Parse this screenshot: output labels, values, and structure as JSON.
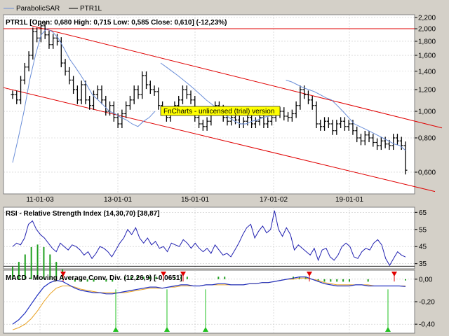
{
  "legend": [
    {
      "name": "ParabolicSAR",
      "color": "#6a8ed8"
    },
    {
      "name": "PTR1L",
      "color": "#000000"
    }
  ],
  "colors": {
    "panel_bg": "#ffffff",
    "frame_bg": "#d4d0c8",
    "channel": "#e00000",
    "sar": "#6a8ed8",
    "price": "#000000",
    "rsi": "#2020b0",
    "macd_line": "#2030c0",
    "signal_line": "#e8a020",
    "macd_hist": "#20a020",
    "marker_down": "#e00000",
    "marker_up": "#20c020",
    "watermark_bg": "#ffff00"
  },
  "price_panel": {
    "header": "PTR1L [Open: 0,680  High: 0,715  Low: 0,585  Close: 0,610] (-12,23%)",
    "watermark": "FnCharts - unlicensed (trial) version",
    "y_ticks": [
      "2,200",
      "2,000",
      "1,800",
      "1,600",
      "1,400",
      "1,200",
      "1,000",
      "0,800",
      "0,600"
    ],
    "x_ticks": [
      "11-01-03",
      "13-01-01",
      "15-01-01",
      "17-01-02",
      "19-01-01"
    ]
  },
  "rsi_panel": {
    "header": "RSI - Relative Strength Index (14,30,70) [38,87]",
    "y_ticks": [
      "65",
      "55",
      "45",
      "35"
    ]
  },
  "macd_panel": {
    "header": "MACD - Moving Average Conv. Div. (12,26,9) [-0,0651]",
    "y_ticks": [
      "0,00",
      "-0,20",
      "-0,40"
    ]
  },
  "chart_data": [
    {
      "type": "ohlc",
      "title": "PTR1L",
      "scale": "log",
      "ylim": [
        0.5,
        2.2
      ],
      "x_tick_labels": [
        "11-01-03",
        "13-01-01",
        "15-01-01",
        "17-01-02",
        "19-01-01"
      ],
      "series": [
        {
          "name": "PTR1L",
          "close": [
            1.15,
            1.1,
            1.3,
            1.45,
            1.6,
            1.95,
            1.85,
            2.05,
            1.9,
            1.75,
            1.85,
            1.8,
            1.5,
            1.4,
            1.3,
            1.2,
            1.1,
            1.25,
            1.1,
            1.05,
            1.15,
            1.2,
            1.1,
            1.0,
            1.05,
            0.95,
            0.9,
            0.98,
            1.05,
            1.1,
            1.2,
            1.15,
            1.35,
            1.25,
            1.2,
            1.18,
            1.05,
            1.0,
            0.95,
            1.0,
            1.05,
            1.1,
            1.2,
            1.15,
            1.1,
            0.95,
            0.9,
            0.88,
            0.92,
            1.0,
            1.05,
            1.02,
            0.95,
            0.92,
            0.95,
            0.93,
            0.9,
            0.92,
            0.95,
            0.9,
            0.92,
            0.95,
            0.9,
            0.92,
            0.95,
            0.98,
            1.0,
            0.96,
            0.95,
            0.98,
            1.05,
            1.2,
            1.15,
            1.1,
            1.05,
            0.9,
            0.88,
            0.92,
            0.9,
            0.85,
            0.9,
            0.92,
            0.88,
            0.9,
            0.85,
            0.8,
            0.78,
            0.82,
            0.8,
            0.77,
            0.75,
            0.78,
            0.76,
            0.75,
            0.8,
            0.78,
            0.75,
            0.61
          ]
        },
        {
          "name": "ParabolicSAR",
          "values": [
            0.65,
            0.8,
            1.0,
            1.3,
            1.6,
            1.9,
            2.0,
            1.95,
            1.85,
            1.7,
            1.55,
            1.45,
            1.35,
            1.25,
            1.15,
            1.1,
            1.05,
            1.0,
            0.98,
            0.95,
            0.93,
            0.9,
            0.88,
            0.92,
            0.95,
            1.0,
            1.5,
            1.45,
            1.4,
            1.35,
            1.3,
            1.25,
            1.2,
            1.15,
            1.1,
            1.06,
            1.02,
            0.98,
            0.95,
            0.92,
            0.9,
            0.9,
            0.92,
            0.93,
            0.95,
            0.96,
            0.97,
            0.98,
            1.3,
            1.28,
            1.25,
            1.22,
            1.2,
            1.18,
            1.15,
            1.12,
            1.1,
            1.05,
            1.0,
            0.95,
            0.9,
            0.88,
            0.86,
            0.84,
            0.82,
            0.8,
            0.78,
            0.76,
            0.75,
            0.72
          ]
        }
      ]
    },
    {
      "type": "line",
      "title": "RSI - Relative Strength Index (14,30,70)",
      "ylim": [
        32,
        68
      ],
      "series": [
        {
          "name": "RSI",
          "values": [
            45,
            47,
            46,
            50,
            58,
            60,
            55,
            52,
            50,
            47,
            44,
            42,
            47,
            45,
            43,
            46,
            45,
            43,
            40,
            42,
            38,
            41,
            45,
            44,
            42,
            39,
            43,
            47,
            50,
            55,
            52,
            56,
            50,
            47,
            50,
            46,
            48,
            44,
            45,
            42,
            47,
            46,
            45,
            49,
            47,
            44,
            47,
            44,
            42,
            44,
            41,
            46,
            43,
            40,
            41,
            39,
            43,
            47,
            52,
            56,
            58,
            50,
            54,
            57,
            53,
            55,
            66,
            55,
            51,
            56,
            52,
            43,
            46,
            44,
            42,
            40,
            44,
            37,
            43,
            44,
            39,
            37,
            40,
            45,
            47,
            45,
            39,
            38,
            42,
            44,
            43,
            47,
            49,
            46,
            38,
            34,
            38,
            42,
            40,
            38.87
          ]
        }
      ]
    },
    {
      "type": "line",
      "title": "MACD - Moving Average Conv. Div. (12,26,9)",
      "ylim": [
        -0.48,
        0.08
      ],
      "series": [
        {
          "name": "MACD",
          "values": [
            -0.4,
            -0.36,
            -0.3,
            -0.22,
            -0.14,
            -0.07,
            -0.03,
            -0.01,
            -0.02,
            -0.05,
            -0.08,
            -0.1,
            -0.11,
            -0.12,
            -0.12,
            -0.13,
            -0.13,
            -0.12,
            -0.11,
            -0.1,
            -0.09,
            -0.08,
            -0.07,
            -0.07,
            -0.08,
            -0.07,
            -0.06,
            -0.05,
            -0.05,
            -0.06,
            -0.06,
            -0.05,
            -0.05,
            -0.04,
            -0.04,
            -0.05,
            -0.05,
            -0.05,
            -0.04,
            -0.04,
            -0.03,
            -0.03,
            -0.02,
            -0.01,
            0.0,
            0.01,
            0.02,
            0.02,
            0.0,
            -0.02,
            -0.04,
            -0.05,
            -0.06,
            -0.06,
            -0.06,
            -0.05,
            -0.05,
            -0.06,
            -0.06,
            -0.06,
            -0.06,
            -0.06,
            -0.06,
            -0.0651
          ]
        },
        {
          "name": "Signal",
          "values": [
            -0.45,
            -0.43,
            -0.4,
            -0.35,
            -0.28,
            -0.2,
            -0.13,
            -0.08,
            -0.06,
            -0.06,
            -0.07,
            -0.09,
            -0.1,
            -0.11,
            -0.12,
            -0.12,
            -0.12,
            -0.12,
            -0.12,
            -0.11,
            -0.1,
            -0.09,
            -0.08,
            -0.08,
            -0.08,
            -0.07,
            -0.07,
            -0.06,
            -0.06,
            -0.06,
            -0.06,
            -0.05,
            -0.05,
            -0.05,
            -0.05,
            -0.05,
            -0.05,
            -0.05,
            -0.04,
            -0.04,
            -0.03,
            -0.03,
            -0.02,
            -0.01,
            0.0,
            0.0,
            0.01,
            0.01,
            0.0,
            -0.01,
            -0.03,
            -0.04,
            -0.05,
            -0.05,
            -0.05,
            -0.05,
            -0.05,
            -0.05,
            -0.06,
            -0.06,
            -0.06,
            -0.06,
            -0.06,
            -0.06
          ]
        }
      ]
    }
  ]
}
